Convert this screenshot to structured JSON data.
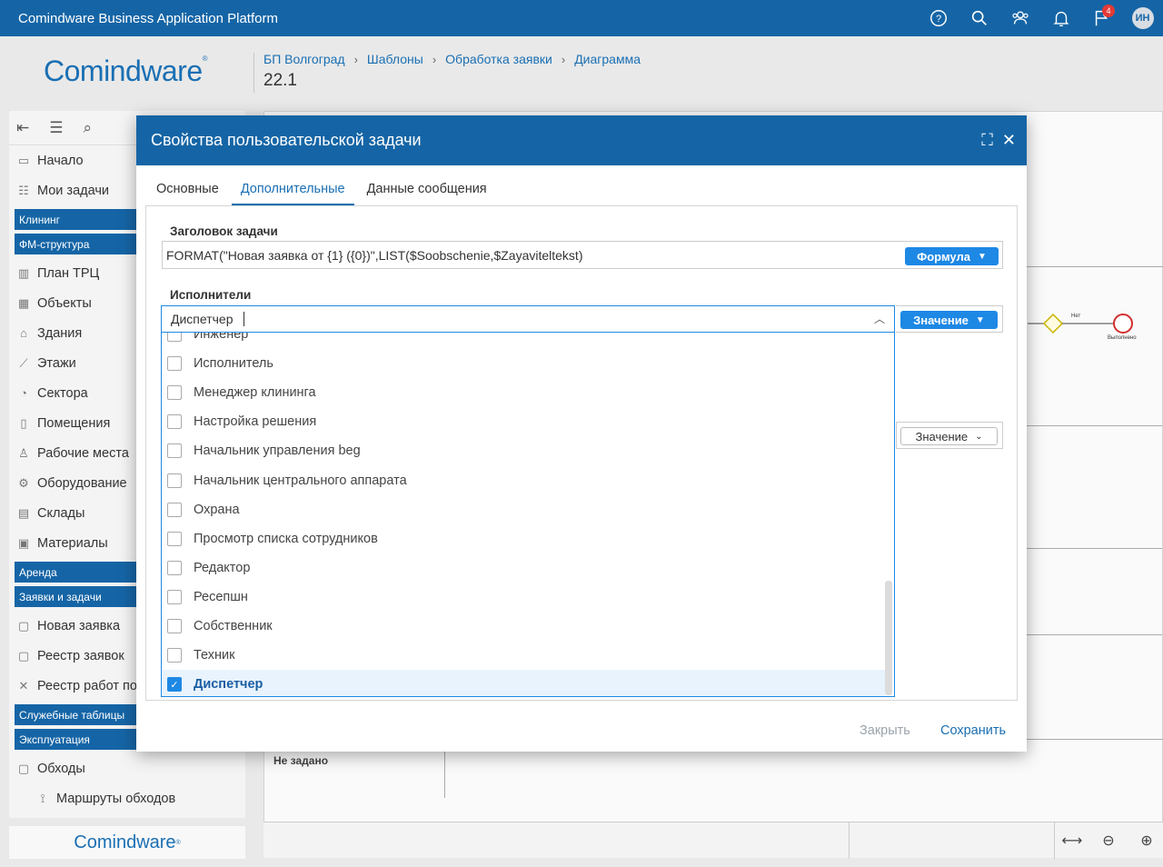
{
  "topbar": {
    "title": "Comindware Business Application Platform",
    "notif_count": "4",
    "avatar": "ИН"
  },
  "header": {
    "logo": "Comindware",
    "breadcrumb": [
      "БП Волгоград",
      "Шаблоны",
      "Обработка заявки",
      "Диаграмма"
    ],
    "version": "22.1"
  },
  "sidebar": {
    "items": [
      {
        "label": "Начало",
        "icon": "home-outline-icon"
      },
      {
        "label": "Мои задачи",
        "icon": "list-icon"
      }
    ],
    "group_cleaning": "Клининг",
    "group_fm": "ФМ-структура",
    "fm_items": [
      "План ТРЦ",
      "Объекты",
      "Здания",
      "Этажи",
      "Сектора",
      "Помещения",
      "Рабочие места",
      "Оборудование",
      "Склады",
      "Материалы"
    ],
    "group_rent": "Аренда",
    "group_requests": "Заявки и задачи",
    "request_items": [
      "Новая заявка",
      "Реестр заявок",
      "Реестр работ по"
    ],
    "group_service": "Служебные таблицы",
    "group_exploit": "Эксплуатация",
    "exploit_items": [
      "Обходы"
    ],
    "sub_items": [
      "Маршруты обходов"
    ],
    "footer_logo": "Comindware"
  },
  "canvas": {
    "lane_label": "Не задано",
    "node_labels": [
      "Нет",
      "Выполнено"
    ]
  },
  "dialog": {
    "title": "Свойства пользовательской задачи",
    "tabs": [
      "Основные",
      "Дополнительные",
      "Данные сообщения"
    ],
    "active_tab": 1,
    "task_title_label": "Заголовок задачи",
    "task_title_value": "FORMAT(\"Новая заявка от {1} ({0})\",LIST($Soobschenie,$Zayaviteltekst)",
    "task_title_mode": "Формула",
    "performers_label": "Исполнители",
    "performers_value": "Диспетчер",
    "performers_mode": "Значение",
    "third_mode": "Значение",
    "options": [
      {
        "label": "Инженер",
        "checked": false
      },
      {
        "label": "Исполнитель",
        "checked": false
      },
      {
        "label": "Менеджер клининга",
        "checked": false
      },
      {
        "label": "Настройка решения",
        "checked": false
      },
      {
        "label": "Начальник управления beg",
        "checked": false
      },
      {
        "label": "Начальник центрального аппарата",
        "checked": false
      },
      {
        "label": "Охрана",
        "checked": false
      },
      {
        "label": "Просмотр списка сотрудников",
        "checked": false
      },
      {
        "label": "Редактор",
        "checked": false
      },
      {
        "label": "Ресепшн",
        "checked": false
      },
      {
        "label": "Собственник",
        "checked": false
      },
      {
        "label": "Техник",
        "checked": false
      },
      {
        "label": "Диспетчер",
        "checked": true
      }
    ],
    "close_label": "Закрыть",
    "save_label": "Сохранить"
  },
  "colors": {
    "primary": "#1565a6",
    "accent": "#1e88e5",
    "badge": "#e53935"
  }
}
